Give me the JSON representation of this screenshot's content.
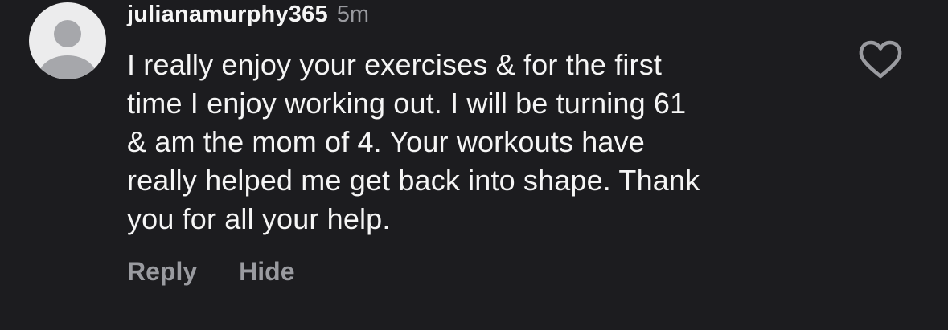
{
  "comment": {
    "username": "julianamurphy365",
    "timestamp": "5m",
    "lines": [
      "I really enjoy your exercises & for the first",
      "time I enjoy working out. I will be turning 61",
      "& am the mom of 4. Your workouts have",
      "really helped me get back into shape. Thank",
      "you for all your help."
    ],
    "avatar_icon": "default-profile-icon",
    "like_icon": "heart-outline-icon"
  },
  "actions": {
    "reply_label": "Reply",
    "hide_label": "Hide"
  },
  "colors": {
    "background": "#1c1c1f",
    "primary_text": "#f5f5f5",
    "secondary_text": "#9a9ba0",
    "avatar_bg": "#ececed",
    "avatar_figure": "#a6a7ab"
  }
}
